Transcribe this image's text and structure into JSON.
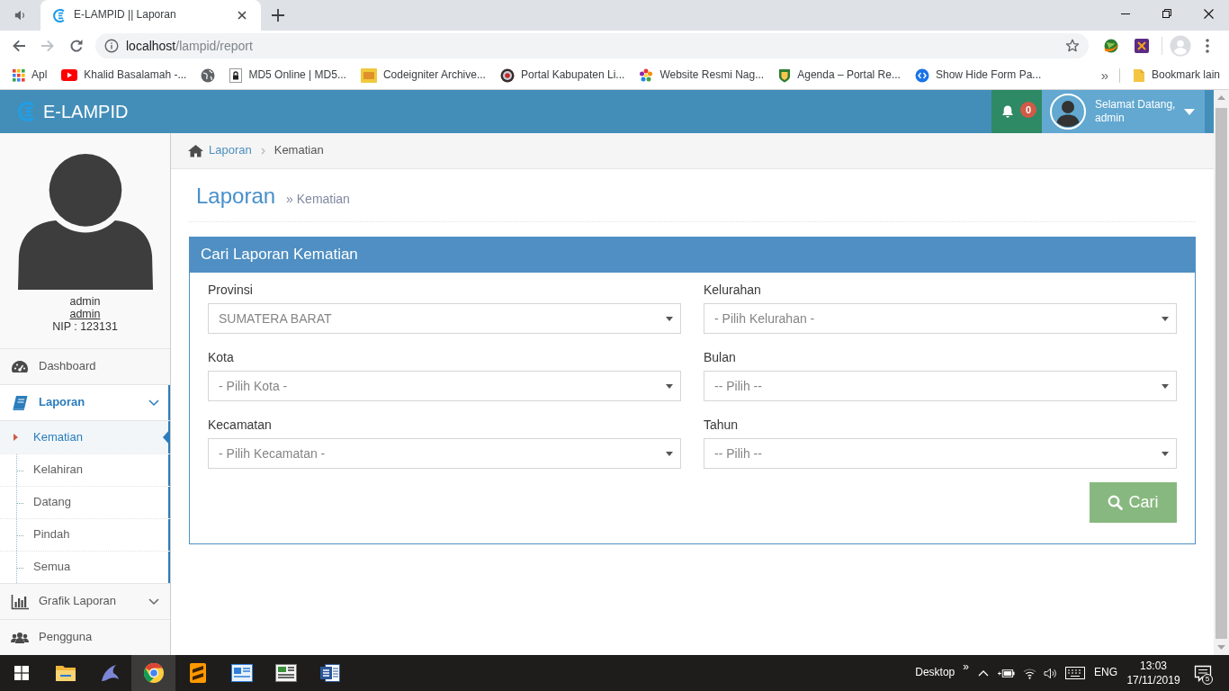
{
  "browser": {
    "tab": {
      "title": "E-LAMPID || Laporan"
    },
    "address": {
      "host": "localhost",
      "path": "/lampid/report"
    },
    "bookmarks": [
      {
        "kind": "page",
        "label": "Apl"
      },
      {
        "kind": "page",
        "label": "Khalid Basalamah -..."
      },
      {
        "kind": "icon-only"
      },
      {
        "kind": "page",
        "label": "MD5 Online | MD5..."
      },
      {
        "kind": "page",
        "label": "Codeigniter Archive..."
      },
      {
        "kind": "page",
        "label": "Portal Kabupaten Li..."
      },
      {
        "kind": "page",
        "label": "Website Resmi Nag..."
      },
      {
        "kind": "page",
        "label": "Agenda – Portal Re..."
      },
      {
        "kind": "page",
        "label": "Show Hide Form Pa..."
      }
    ],
    "bookmarks_overflow": "»",
    "other_bookmarks": "Bookmark lain"
  },
  "header": {
    "brand": "E-LAMPID",
    "notification_count": "0",
    "greeting": "Selamat Datang,",
    "user": "admin"
  },
  "sidebar": {
    "profile": {
      "name": "admin",
      "username": "admin",
      "nip": "NIP : 123131"
    },
    "menu": [
      {
        "label": "Dashboard",
        "selected": false
      },
      {
        "label": "Laporan",
        "selected": true,
        "expanded": true,
        "children": [
          {
            "label": "Kematian",
            "selected": true
          },
          {
            "label": "Kelahiran",
            "selected": false
          },
          {
            "label": "Datang",
            "selected": false
          },
          {
            "label": "Pindah",
            "selected": false
          },
          {
            "label": "Semua",
            "selected": false
          }
        ]
      },
      {
        "label": "Grafik Laporan",
        "selected": false,
        "expanded": false
      },
      {
        "label": "Pengguna",
        "selected": false
      }
    ]
  },
  "breadcrumb": [
    {
      "kind": "link",
      "label": "Laporan"
    },
    {
      "kind": "current",
      "label": "Kematian"
    }
  ],
  "page_header": {
    "title": "Laporan",
    "subtitle": "» Kematian"
  },
  "search_panel": {
    "title": "Cari Laporan Kematian",
    "columns": [
      {
        "fields": [
          {
            "label": "Provinsi",
            "value": "SUMATERA BARAT"
          },
          {
            "label": "Kota",
            "value": "- Pilih Kota -"
          },
          {
            "label": "Kecamatan",
            "value": "- Pilih Kecamatan -"
          }
        ]
      },
      {
        "fields": [
          {
            "label": "Kelurahan",
            "value": "- Pilih Kelurahan -"
          },
          {
            "label": "Bulan",
            "value": "-- Pilih --"
          },
          {
            "label": "Tahun",
            "value": "-- Pilih --"
          }
        ]
      }
    ],
    "button": "Cari"
  },
  "taskbar": {
    "apps": [
      {
        "selected": false
      },
      {
        "selected": false
      },
      {
        "selected": true
      },
      {
        "selected": false
      },
      {
        "selected": false
      },
      {
        "selected": false
      },
      {
        "selected": false
      }
    ],
    "tray": {
      "desktop": "Desktop",
      "overflow": "»",
      "language": "ENG",
      "time": "13:03",
      "date": "17/11/2019",
      "notifications": "5"
    }
  }
}
